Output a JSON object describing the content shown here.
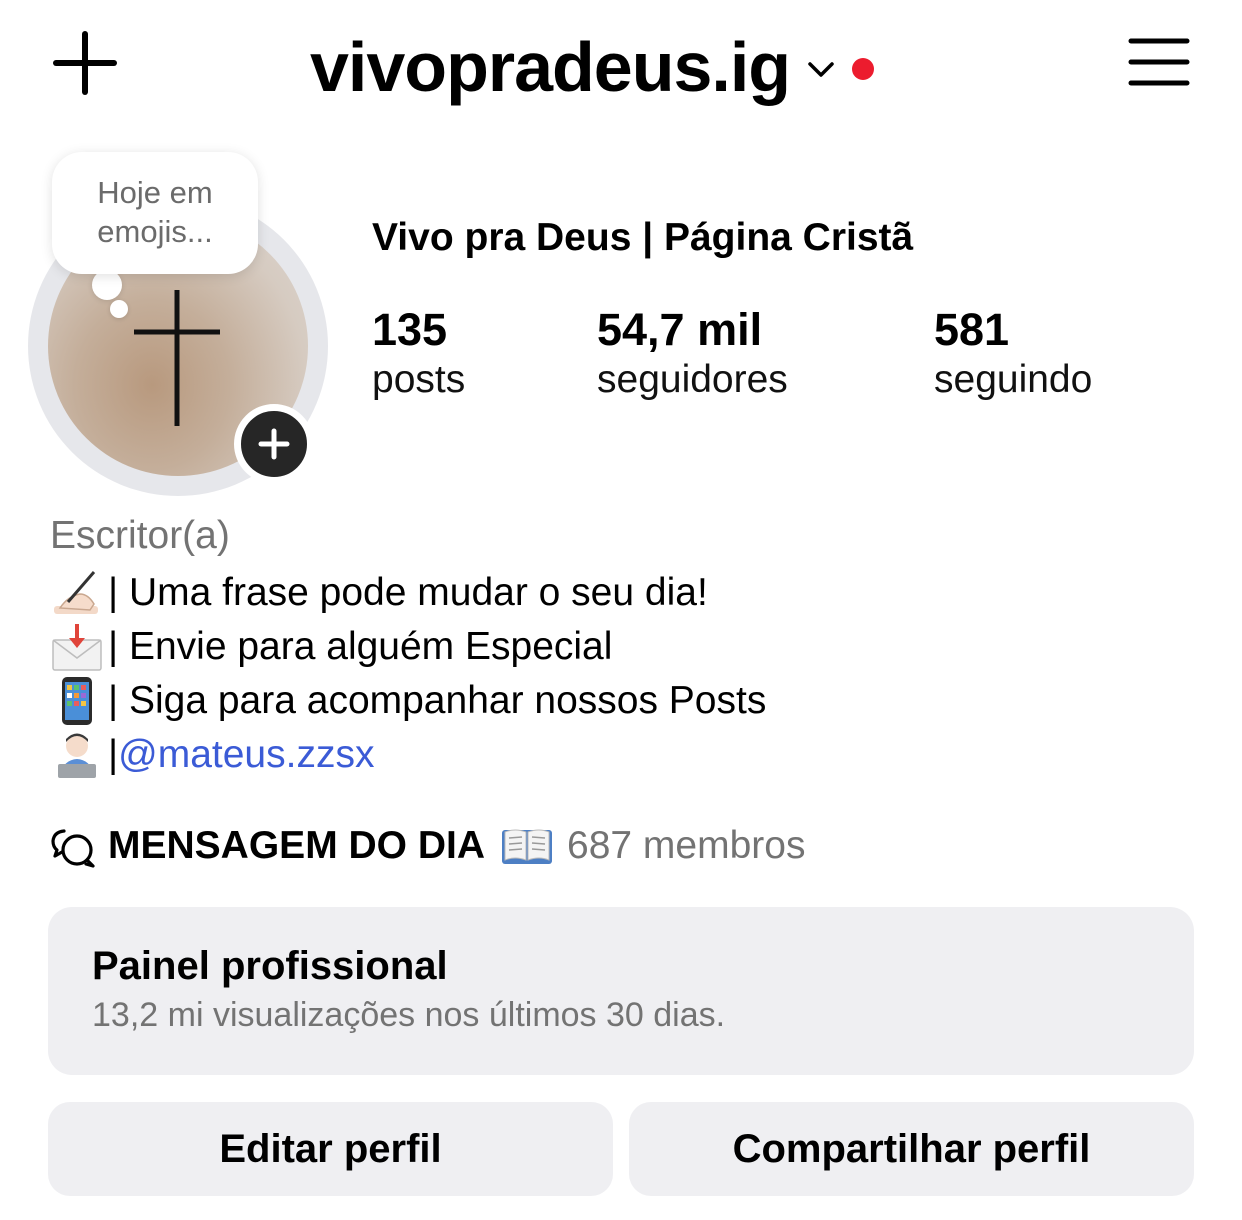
{
  "header": {
    "username": "vivopradeus.ig",
    "notification_color": "#ec1c2e"
  },
  "profile": {
    "note": "Hoje em emojis...",
    "display_name": "Vivo pra Deus | Página Cristã",
    "stats": {
      "posts": {
        "value": "135",
        "label": "posts"
      },
      "followers": {
        "value": "54,7 mil",
        "label": "seguidores"
      },
      "following": {
        "value": "581",
        "label": "seguindo"
      }
    }
  },
  "bio": {
    "category": "Escritor(a)",
    "lines": [
      {
        "emoji": "writing-hand",
        "text": "| Uma frase pode mudar o seu dia!"
      },
      {
        "emoji": "envelope-with-arrow",
        "text": "| Envie para alguém Especial"
      },
      {
        "emoji": "mobile-phone",
        "text": "| Siga para acompanhar nossos Posts"
      },
      {
        "emoji": "technologist",
        "text": "| ",
        "link": "@mateus.zzsx"
      }
    ],
    "link_color": "#3b5bd6"
  },
  "channel": {
    "name": "MENSAGEM DO DIA",
    "members": "687 membros"
  },
  "dashboard": {
    "title": "Painel profissional",
    "subtitle": "13,2 mi visualizações nos últimos 30 dias."
  },
  "buttons": {
    "edit": "Editar perfil",
    "share": "Compartilhar perfil"
  }
}
